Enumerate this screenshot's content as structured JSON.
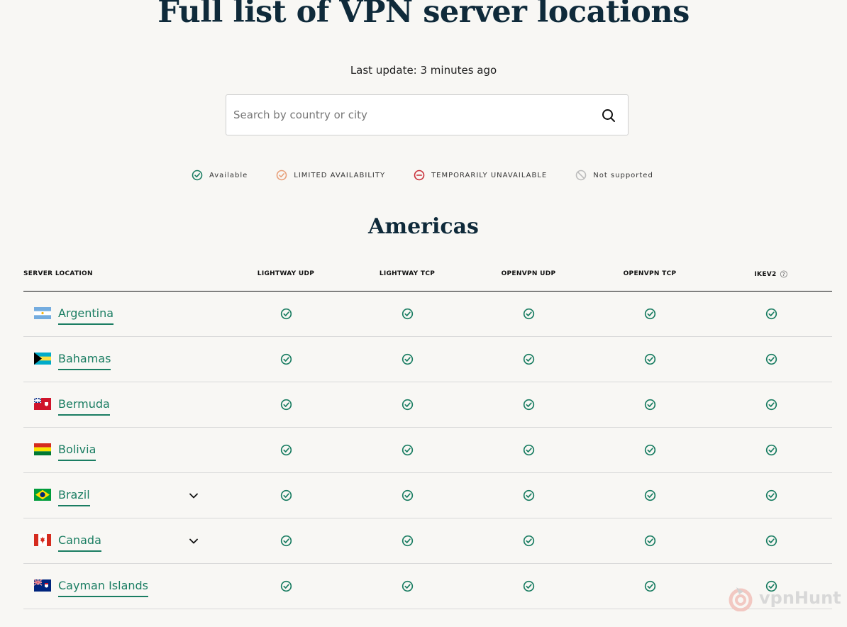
{
  "page": {
    "title": "Full list of VPN server locations",
    "last_update": "Last update: 3 minutes ago"
  },
  "search": {
    "placeholder": "Search by country or city",
    "value": ""
  },
  "legend": [
    {
      "label": "Available",
      "icon": "check-circle-icon",
      "color": "#1a7d62"
    },
    {
      "label": "LIMITED AVAILABILITY",
      "icon": "check-circle-icon",
      "color": "#e8a07a"
    },
    {
      "label": "TEMPORARILY UNAVAILABLE",
      "icon": "minus-circle-icon",
      "color": "#c9303a"
    },
    {
      "label": "Not supported",
      "icon": "ban-circle-icon",
      "color": "#bdbdbd"
    }
  ],
  "region": {
    "name": "Americas"
  },
  "table": {
    "headers": [
      "SERVER LOCATION",
      "LIGHTWAY UDP",
      "LIGHTWAY TCP",
      "OPENVPN UDP",
      "OPENVPN TCP",
      "IKEV2"
    ],
    "rows": [
      {
        "country": "Argentina",
        "flag": "argentina",
        "expandable": false,
        "status": [
          "available",
          "available",
          "available",
          "available",
          "available"
        ]
      },
      {
        "country": "Bahamas",
        "flag": "bahamas",
        "expandable": false,
        "status": [
          "available",
          "available",
          "available",
          "available",
          "available"
        ]
      },
      {
        "country": "Bermuda",
        "flag": "bermuda",
        "expandable": false,
        "status": [
          "available",
          "available",
          "available",
          "available",
          "available"
        ]
      },
      {
        "country": "Bolivia",
        "flag": "bolivia",
        "expandable": false,
        "status": [
          "available",
          "available",
          "available",
          "available",
          "available"
        ]
      },
      {
        "country": "Brazil",
        "flag": "brazil",
        "expandable": true,
        "status": [
          "available",
          "available",
          "available",
          "available",
          "available"
        ]
      },
      {
        "country": "Canada",
        "flag": "canada",
        "expandable": true,
        "status": [
          "available",
          "available",
          "available",
          "available",
          "available"
        ]
      },
      {
        "country": "Cayman Islands",
        "flag": "cayman-islands",
        "expandable": false,
        "status": [
          "available",
          "available",
          "available",
          "available",
          "available"
        ]
      }
    ]
  },
  "colors": {
    "accent": "#1a7d62",
    "heading": "#0f2a3a",
    "background": "#f8f7f4"
  },
  "watermark": {
    "text": "vpnHunt"
  }
}
